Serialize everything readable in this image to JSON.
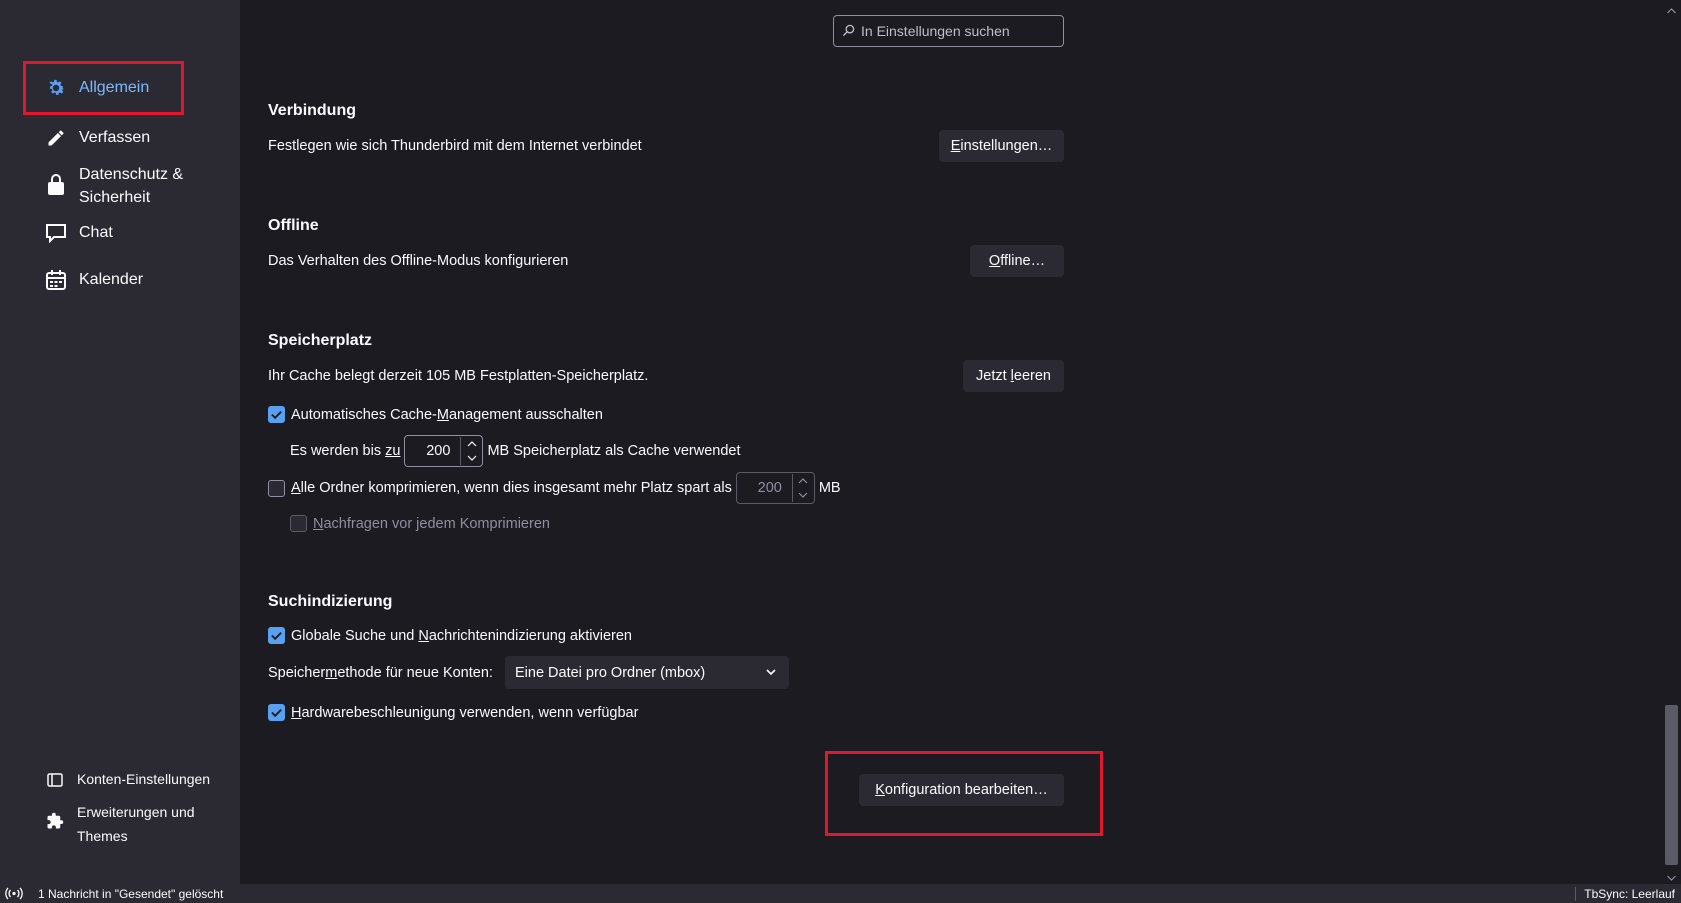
{
  "sidebar": {
    "items": [
      {
        "label": "Allgemein",
        "icon": "gear-icon"
      },
      {
        "label": "Verfassen",
        "icon": "pencil-icon"
      },
      {
        "label_line1": "Datenschutz &",
        "label_line2": "Sicherheit",
        "icon": "lock-icon"
      },
      {
        "label": "Chat",
        "icon": "chat-icon"
      },
      {
        "label": "Kalender",
        "icon": "calendar-icon"
      }
    ],
    "bottom": [
      {
        "label": "Konten-Einstellungen",
        "icon": "account-icon"
      },
      {
        "label_line1": "Erweiterungen und",
        "label_line2": "Themes",
        "icon": "puzzle-icon"
      }
    ]
  },
  "search": {
    "placeholder": "In Einstellungen suchen"
  },
  "verbindung": {
    "title": "Verbindung",
    "desc": "Festlegen wie sich Thunderbird mit dem Internet verbindet",
    "button_first": "E",
    "button_rest": "instellungen…"
  },
  "offline": {
    "title": "Offline",
    "desc": "Das Verhalten des Offline-Modus konfigurieren",
    "button_first": "O",
    "button_rest": "ffline…"
  },
  "speicherplatz": {
    "title": "Speicherplatz",
    "desc": "Ihr Cache belegt derzeit 105 MB Festplatten-Speicherplatz.",
    "button_pre": "Jetzt ",
    "button_u": "l",
    "button_post": "eeren",
    "auto_cache_pre": "Automatisches Cache-",
    "auto_cache_u": "M",
    "auto_cache_post": "anagement ausschalten",
    "cache_size_pre": "Es werden bis ",
    "cache_size_u": "zu",
    "cache_size_value": "200",
    "cache_size_post": "MB Speicherplatz als Cache verwendet",
    "compact_u": "A",
    "compact_post": "lle Ordner komprimieren, wenn dies insgesamt mehr Platz spart als",
    "compact_value": "200",
    "compact_unit": "MB",
    "ask_u": "N",
    "ask_post": "achfragen vor jedem Komprimieren"
  },
  "suchindizierung": {
    "title": "Suchindizierung",
    "global_pre": "Globale Suche und ",
    "global_u": "N",
    "global_post": "achrichtenindizierung aktivieren",
    "store_pre": "Speicher",
    "store_u": "m",
    "store_post": "ethode für neue Konten:",
    "store_value": "Eine Datei pro Ordner (mbox)",
    "hw_u": "H",
    "hw_post": "ardwarebeschleunigung verwenden, wenn verfügbar"
  },
  "config_button": {
    "first": "K",
    "rest": "onfiguration bearbeiten…"
  },
  "status": {
    "message": "1 Nachricht in \"Gesendet\" gelöscht",
    "right": "TbSync: Leerlauf"
  },
  "colors": {
    "accent": "#5aa0f0",
    "highlight": "#e0182d",
    "background": "#1c1b22",
    "sidebar": "#2b2a33"
  }
}
